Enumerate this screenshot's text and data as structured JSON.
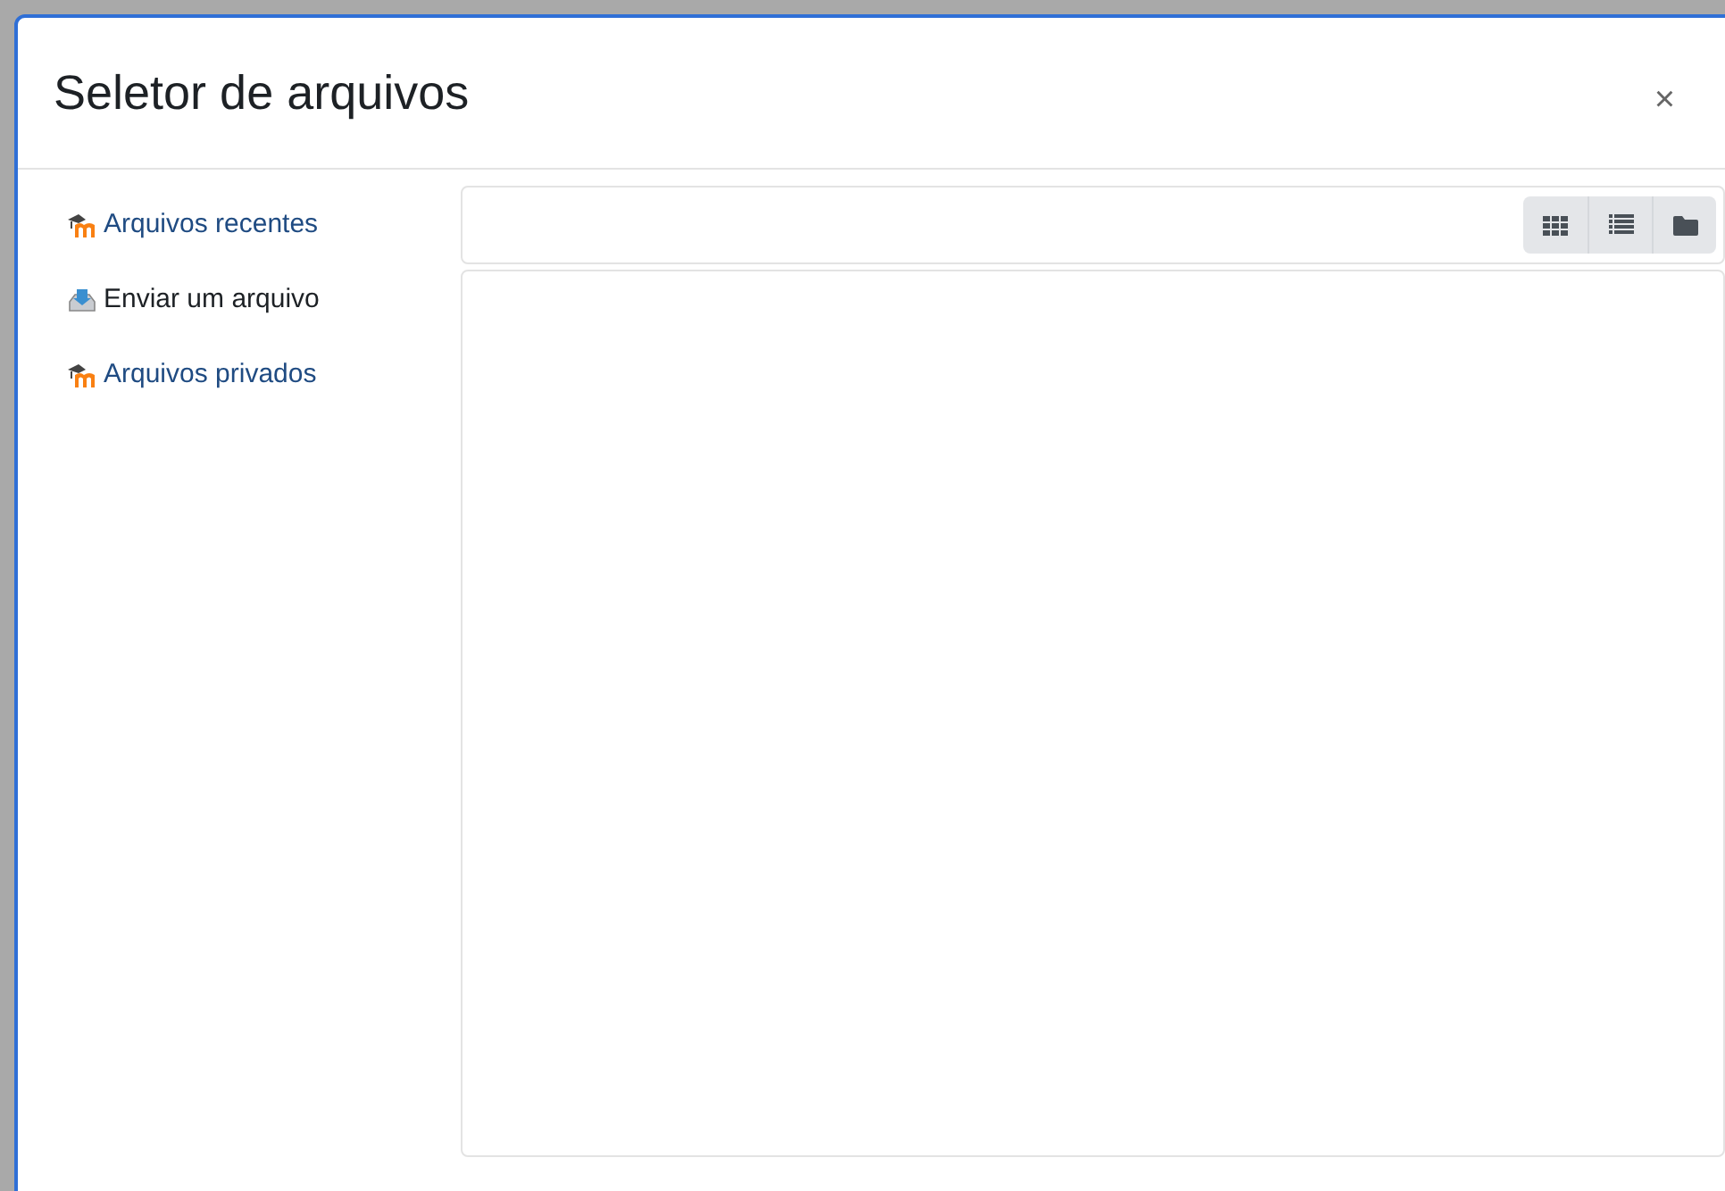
{
  "dialog": {
    "title": "Seletor de arquivos",
    "close": "×"
  },
  "repositories": [
    {
      "label": "Arquivos recentes",
      "kind": "moodle",
      "selected": false
    },
    {
      "label": "Enviar um arquivo",
      "kind": "upload",
      "selected": true
    },
    {
      "label": "Arquivos privados",
      "kind": "moodle",
      "selected": false
    }
  ],
  "view_buttons": [
    {
      "kind": "icons"
    },
    {
      "kind": "list"
    },
    {
      "kind": "tree"
    }
  ]
}
